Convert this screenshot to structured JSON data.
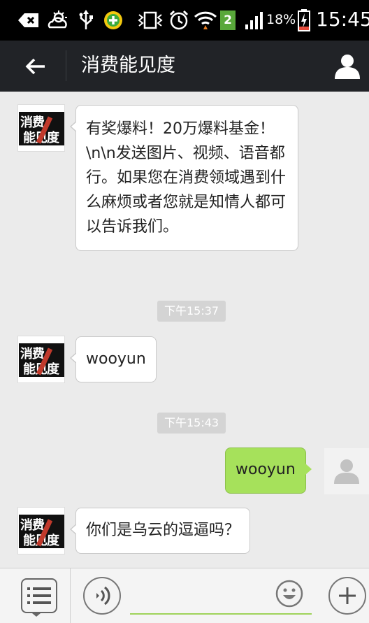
{
  "status_bar": {
    "icons": [
      "back-notification-icon",
      "weather-icon",
      "usb-icon",
      "360-security-icon",
      "vibrate-icon",
      "alarm-icon",
      "wifi-icon",
      "sim-icon",
      "signal-icon",
      "battery-icon"
    ],
    "sim_number": "2",
    "battery_percent": "18%",
    "time": "15:45"
  },
  "header": {
    "title": "消费能见度"
  },
  "brand_avatar": {
    "line1": "消费",
    "line2": "能见度"
  },
  "messages": [
    {
      "direction": "in",
      "text": "有奖爆料！20万爆料基金！\\n\\n发送图片、视频、语音都行。如果您在消费领域遇到什么麻烦或者您就是知情人都可以告诉我们。"
    },
    {
      "type": "timestamp",
      "text": "下午15:37"
    },
    {
      "direction": "in",
      "text": "wooyun"
    },
    {
      "type": "timestamp",
      "text": "下午15:43"
    },
    {
      "direction": "out",
      "text": "wooyun"
    },
    {
      "direction": "in",
      "text": "你们是乌云的逗逼吗？"
    }
  ],
  "input_bar": {
    "value": "",
    "placeholder": ""
  },
  "colors": {
    "title_bar": "#212327",
    "chat_background": "#ebebeb",
    "incoming_bubble": "#ffffff",
    "outgoing_bubble": "#a6e15b",
    "timestamp_bg": "#d4d4d4",
    "input_underline": "#9fd35a"
  }
}
